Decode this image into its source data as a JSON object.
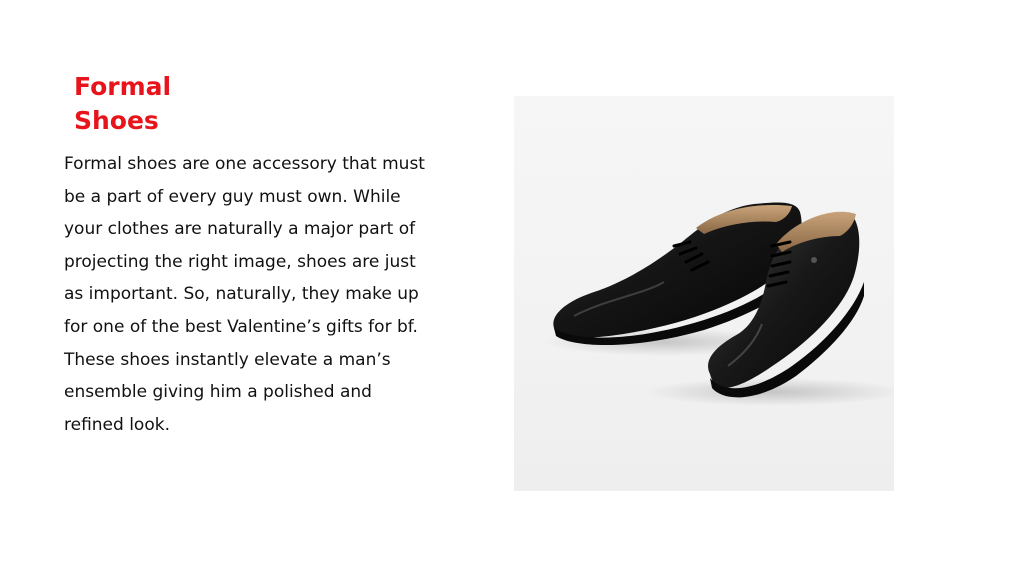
{
  "slide": {
    "title_line1": "Formal",
    "title_line2": "Shoes",
    "body_lines": [
      "Formal shoes are one accessory that must",
      "be a part of every guy must own. While",
      "your clothes are naturally a major part of",
      "projecting the right image, shoes are just",
      "as important. So, naturally, they make up",
      "for one of the best Valentine’s gifts for bf.",
      "These shoes instantly elevate a man’s",
      "ensemble giving him a polished and",
      "refined look."
    ]
  },
  "colors": {
    "title": "#e8141b",
    "text": "#111111",
    "background": "#ffffff"
  }
}
